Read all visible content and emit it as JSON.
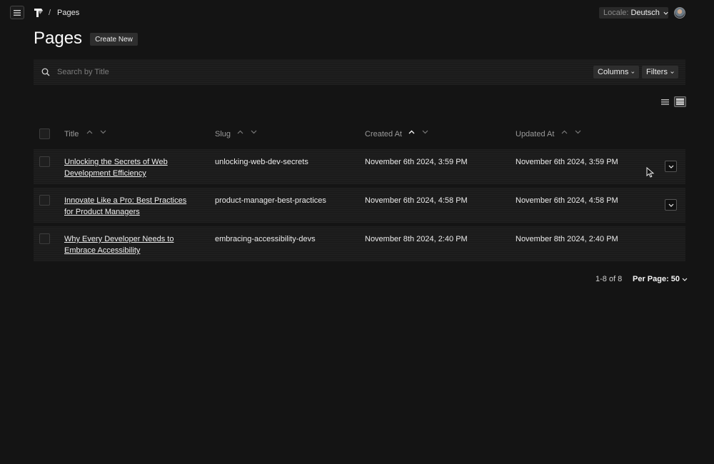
{
  "header": {
    "breadcrumb_separator": "/",
    "breadcrumb_page": "Pages",
    "locale_label": "Locale:",
    "locale_value": "Deutsch"
  },
  "page": {
    "title": "Pages",
    "create_label": "Create New"
  },
  "toolbar": {
    "search_placeholder": "Search by Title",
    "columns_label": "Columns",
    "filters_label": "Filters"
  },
  "table": {
    "columns": [
      "Title",
      "Slug",
      "Created At",
      "Updated At"
    ],
    "rows": [
      {
        "title": "Unlocking the Secrets of Web Development Efficiency",
        "slug": "unlocking-web-dev-secrets",
        "created": "November 6th 2024, 3:59 PM",
        "updated": "November 6th 2024, 3:59 PM"
      },
      {
        "title": "Innovate Like a Pro: Best Practices for Product Managers",
        "slug": "product-manager-best-practices",
        "created": "November 6th 2024, 4:58 PM",
        "updated": "November 6th 2024, 4:58 PM"
      },
      {
        "title": "Why Every Developer Needs to Embrace Accessibility",
        "slug": "embracing-accessibility-devs",
        "created": "November 8th 2024, 2:40 PM",
        "updated": "November 8th 2024, 2:40 PM"
      }
    ]
  },
  "pagination": {
    "range": "1-8 of 8",
    "per_page_label": "Per Page:",
    "per_page_value": "50"
  }
}
